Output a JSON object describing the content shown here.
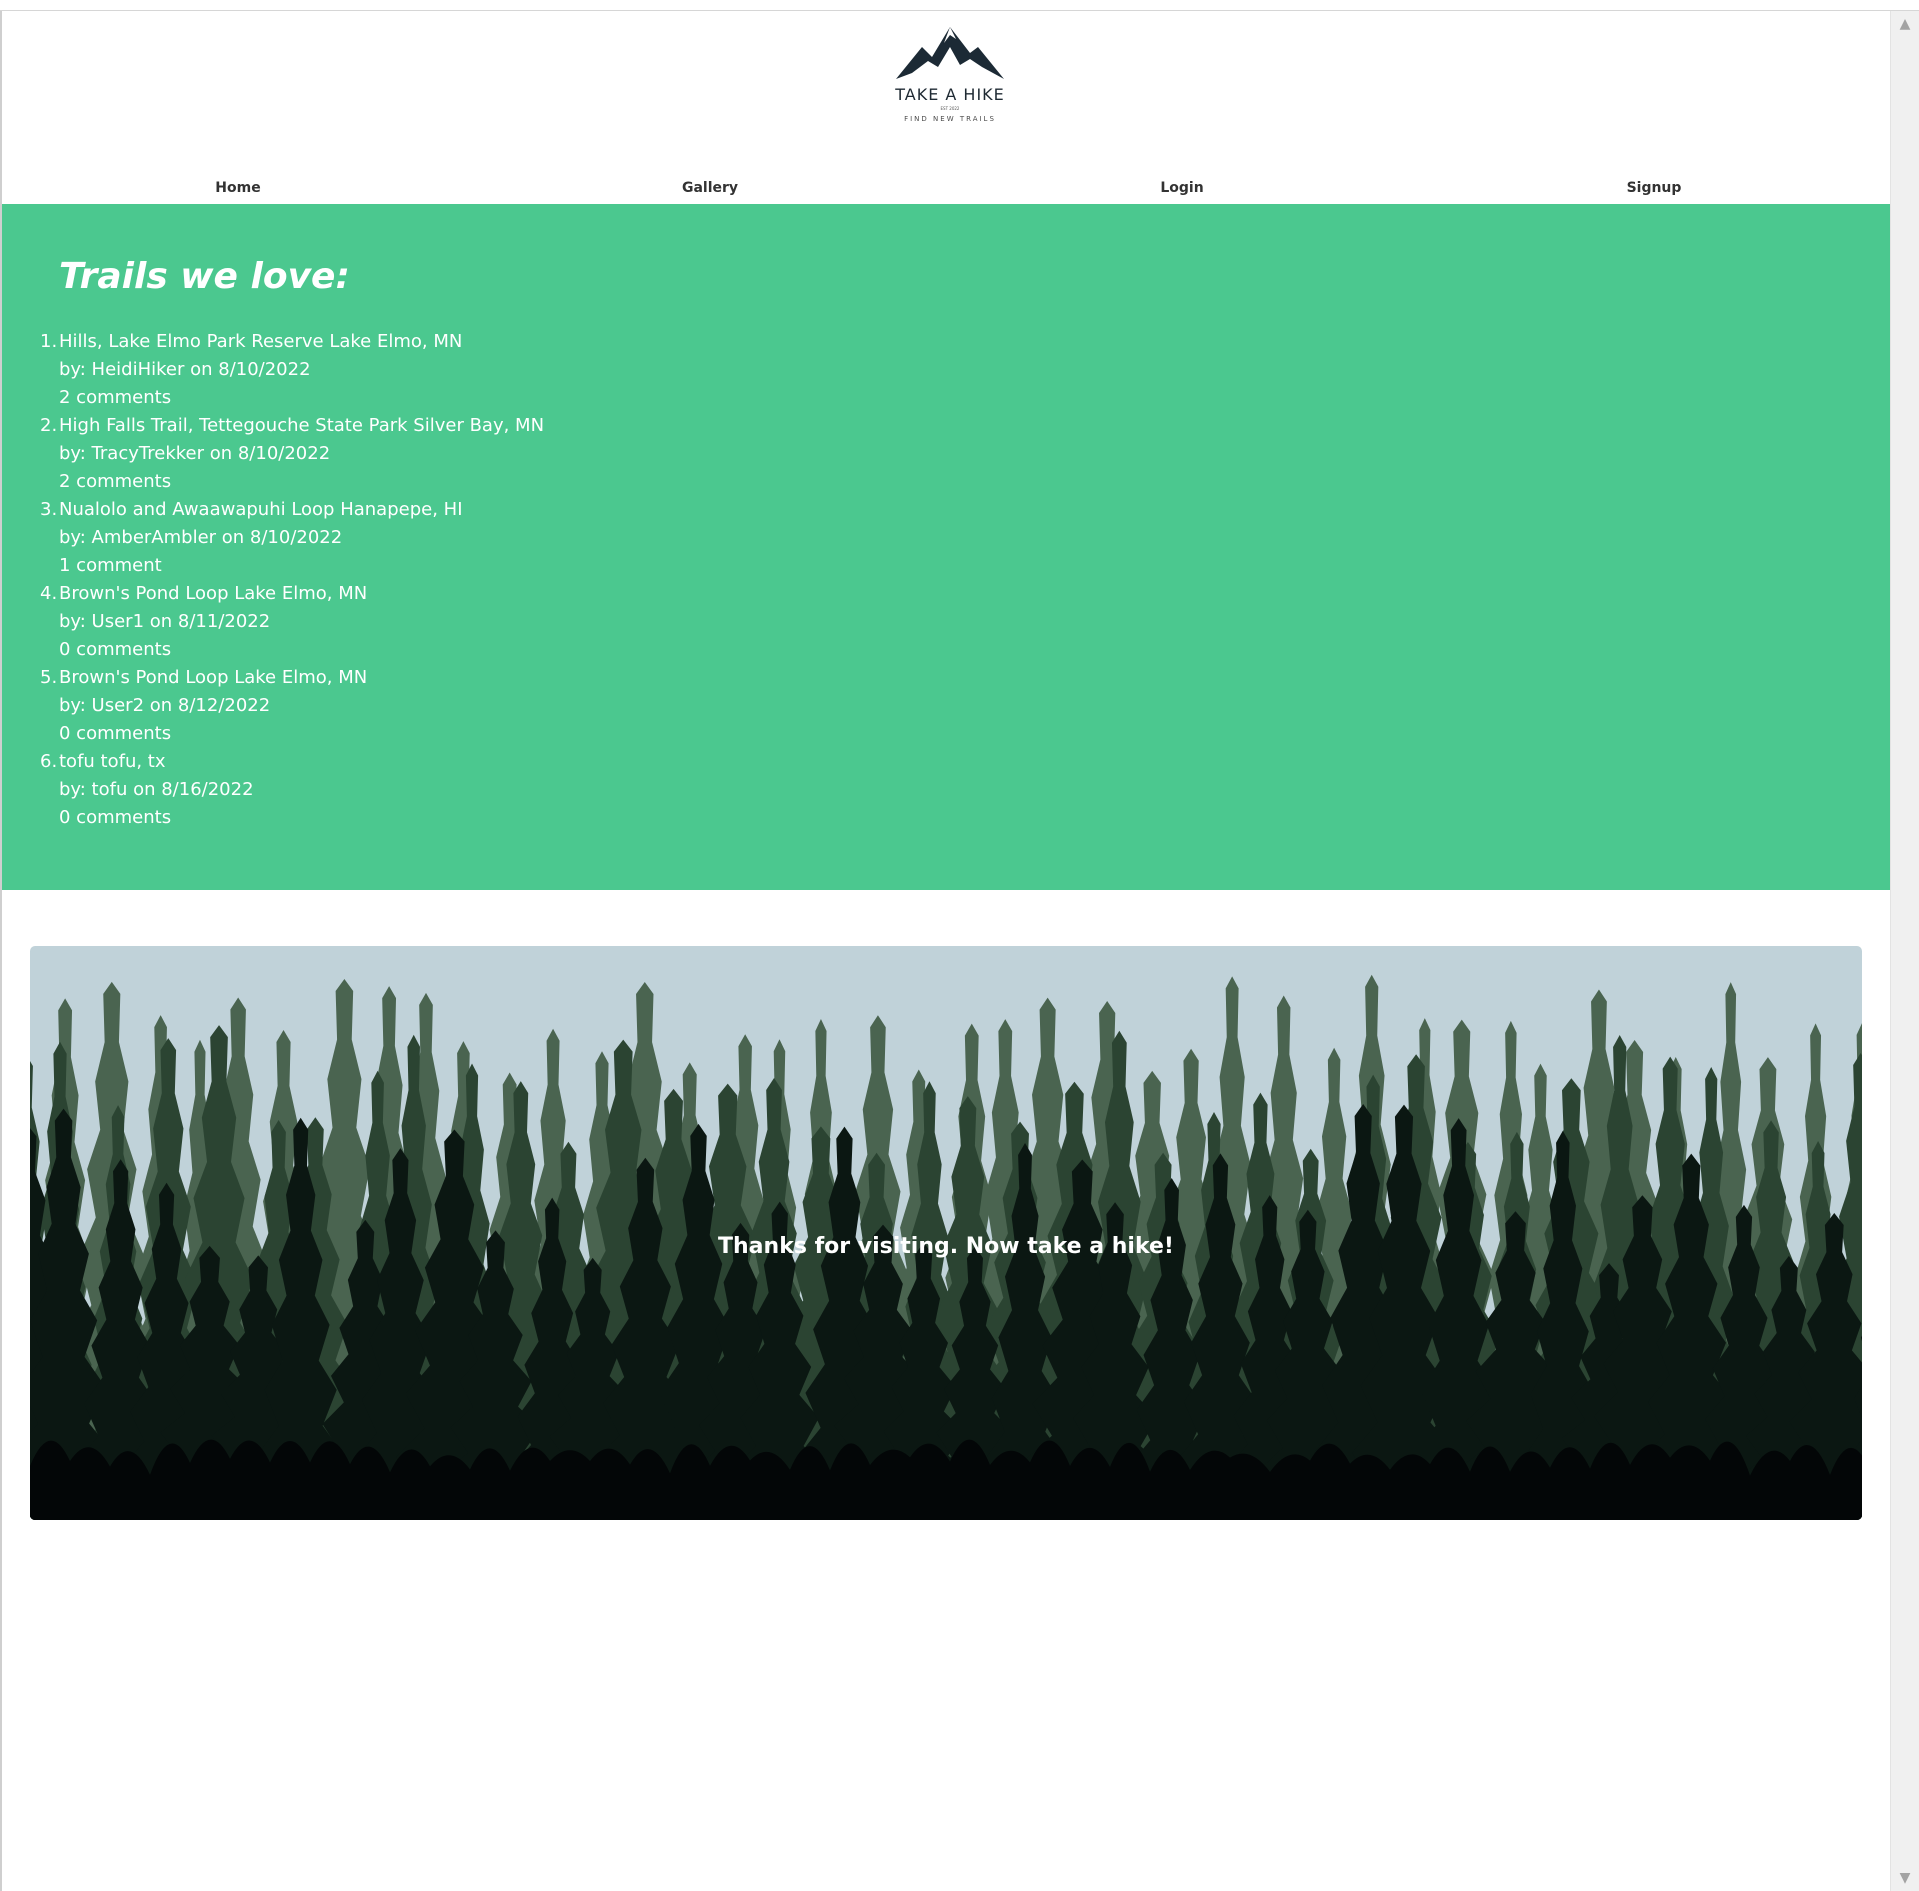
{
  "logo": {
    "title": "TAKE A HIKE",
    "subtitle": "FIND NEW TRAILS",
    "est": "EST 2022"
  },
  "nav": [
    "Home",
    "Gallery",
    "Login",
    "Signup"
  ],
  "trails": {
    "heading": "Trails we love:",
    "items": [
      {
        "num": "1.",
        "title": "Hills, Lake Elmo Park Reserve Lake Elmo, MN",
        "byline": "by: HeidiHiker on 8/10/2022",
        "comments": "2 comments"
      },
      {
        "num": "2.",
        "title": "High Falls Trail, Tettegouche State Park Silver Bay, MN",
        "byline": "by: TracyTrekker on 8/10/2022",
        "comments": "2 comments"
      },
      {
        "num": "3.",
        "title": "Nualolo and Awaawapuhi Loop Hanapepe, HI",
        "byline": "by: AmberAmbler on 8/10/2022",
        "comments": "1 comment"
      },
      {
        "num": "4.",
        "title": "Brown's Pond Loop Lake Elmo, MN",
        "byline": "by: User1 on 8/11/2022",
        "comments": "0 comments"
      },
      {
        "num": "5.",
        "title": "Brown's Pond Loop Lake Elmo, MN",
        "byline": "by: User2 on 8/12/2022",
        "comments": "0 comments"
      },
      {
        "num": "6.",
        "title": "tofu tofu, tx",
        "byline": "by: tofu on 8/16/2022",
        "comments": "0 comments"
      }
    ]
  },
  "footer": {
    "message": "Thanks for visiting. Now take a hike!"
  },
  "colors": {
    "accent": "#4bc88f",
    "sky": "#c0d2d9",
    "forest_dark": "#0b1712",
    "forest_mid": "#2b4432",
    "forest_light": "#4a6450"
  }
}
